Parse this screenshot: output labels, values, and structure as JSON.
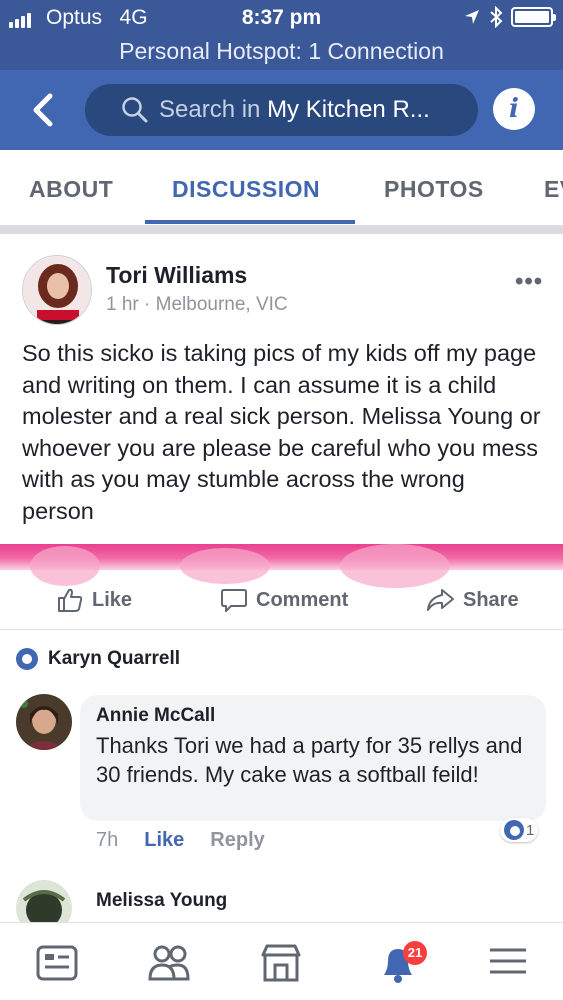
{
  "status_bar": {
    "carrier": "Optus",
    "network": "4G",
    "time": "8:37 pm",
    "hotspot": "Personal Hotspot: 1 Connection"
  },
  "header": {
    "search_prefix": "Search in ",
    "search_group": "My Kitchen R...",
    "info_label": "i",
    "colors": {
      "header": "#4267b2",
      "status": "#3b5998"
    }
  },
  "tabs": [
    {
      "label": "ABOUT",
      "active": false
    },
    {
      "label": "DISCUSSION",
      "active": true
    },
    {
      "label": "PHOTOS",
      "active": false
    },
    {
      "label": "EV",
      "active": false
    }
  ],
  "post": {
    "author": "Tori Williams",
    "time": "1 hr",
    "separator": "·",
    "location": "Melbourne, VIC",
    "text": "So this sicko is taking pics of my kids off my page and writing on them. I can assume it is a child molester and a real sick person. Melissa Young or whoever you are please be careful who you mess with as you may stumble across the wrong person",
    "more_icon": "more-horizontal-icon",
    "actions": {
      "like": "Like",
      "comment": "Comment",
      "share": "Share"
    }
  },
  "comments": {
    "reactor_name": "Karyn Quarrell",
    "items": [
      {
        "author": "Annie McCall",
        "text": "Thanks Tori we had a party for 35 rellys and 30 friends. My cake was a softball feild!",
        "time": "7h",
        "like": "Like",
        "reply": "Reply",
        "reaction_count": "1"
      },
      {
        "author": "Melissa Young"
      }
    ]
  },
  "bottom_nav": {
    "notification_count": "21",
    "icons": [
      "news-feed-icon",
      "friends-icon",
      "marketplace-icon",
      "notifications-icon",
      "menu-icon"
    ]
  }
}
